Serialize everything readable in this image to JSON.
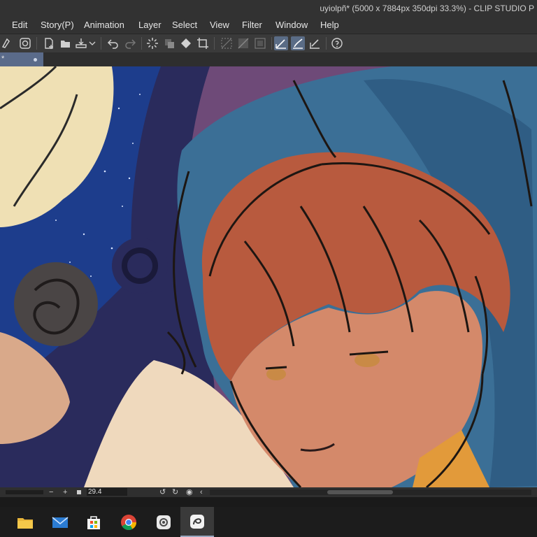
{
  "window": {
    "title": "uyiolpñ* (5000 x 7884px 350dpi 33.3%) - CLIP STUDIO P"
  },
  "menu": {
    "items": [
      "Edit",
      "Story(P)",
      "Animation",
      "Layer",
      "Select",
      "View",
      "Filter",
      "Window",
      "Help"
    ]
  },
  "toolbar": {
    "icons": [
      "new-icon",
      "open-icon",
      "save-icon",
      "undo-icon",
      "redo-icon",
      "loading-icon",
      "transform-icon",
      "fill-icon",
      "crop-icon",
      "snap-icon",
      "snap-ruler-icon",
      "snap-grid-icon",
      "pen-icon",
      "brush-icon",
      "ruler-icon",
      "help-icon"
    ]
  },
  "tab": {
    "label": "*"
  },
  "statusbar": {
    "zoom_value": "29.4",
    "minus_label": "−",
    "plus_label": "+"
  },
  "taskbar": {
    "apps": [
      "file-explorer-icon",
      "mail-icon",
      "store-icon",
      "chrome-icon",
      "clip-studio-icon",
      "clip-studio-paint-icon"
    ]
  },
  "colors": {
    "chrome_bg": "#323232",
    "accent": "#5a6b8a",
    "taskbar_bg": "#1c1c1c"
  }
}
